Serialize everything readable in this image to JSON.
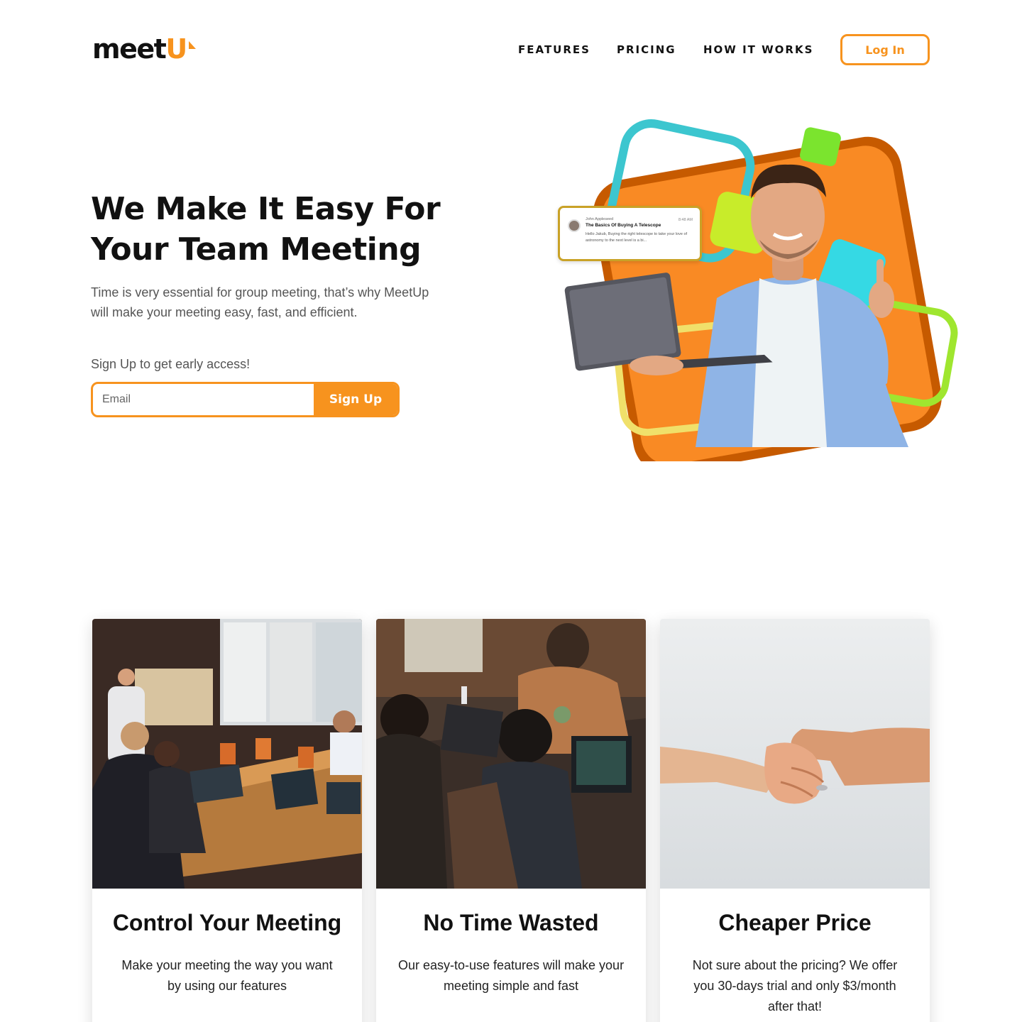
{
  "brand": {
    "logo_text": "meet",
    "logo_accent": "U",
    "accent_color": "#f7931e"
  },
  "nav": {
    "items": [
      "FEATURES",
      "PRICING",
      "HOW IT WORKS"
    ],
    "login_label": "Log In"
  },
  "hero": {
    "title": "We Make It Easy For Your Team Meeting",
    "subtitle": "Time is very essential for group meeting, that’s why MeetUp will make your meeting easy, fast, and efficient.",
    "signup_prompt": "Sign Up to get early access!",
    "email_placeholder": "Email",
    "signup_label": "Sign Up"
  },
  "message_card": {
    "sender": "John Appleseed",
    "time": "8:48 AM",
    "subject": "The Basics Of Buying A Telescope",
    "preview": "Hello Jakub, Buying the right telescope to take your love of astronomy to the next level is a bi..."
  },
  "features": [
    {
      "title": "Control Your Meeting",
      "text": "Make your meeting the way you want by using our features",
      "photo": "team-meeting-photo"
    },
    {
      "title": "No Time Wasted",
      "text": "Our easy-to-use features will make your meeting simple and fast",
      "photo": "laptop-coworkers-photo"
    },
    {
      "title": "Cheaper Price",
      "text": "Not sure about the pricing? We offer you 30-days trial and only $3/month after that!",
      "photo": "handshake-photo"
    }
  ],
  "colors": {
    "orange": "#f7931e",
    "teal": "#3cc6cf",
    "lime": "#7be42e",
    "yellow": "#f0e06a"
  }
}
